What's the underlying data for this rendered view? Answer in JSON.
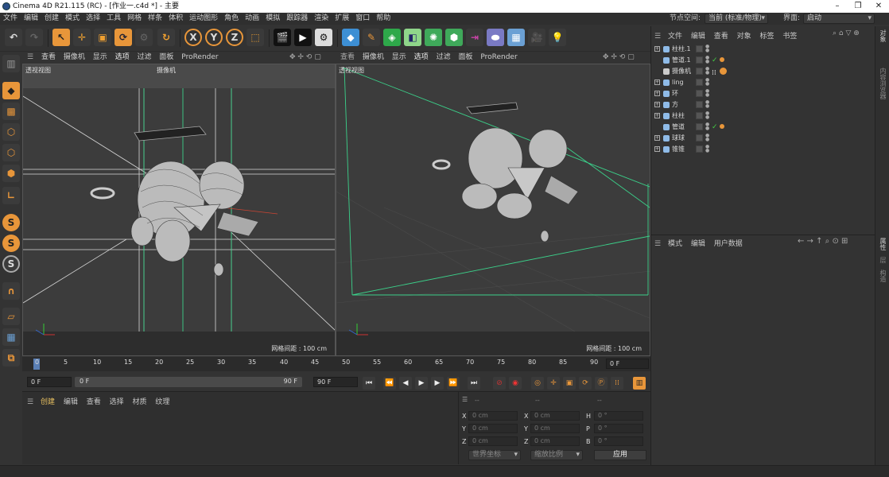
{
  "window": {
    "title": "Cinema 4D R21.115 (RC) - [作业一.c4d *] - 主要",
    "minimize": "–",
    "maximize": "❐",
    "close": "✕"
  },
  "menu": {
    "items": [
      "文件",
      "编辑",
      "创建",
      "模式",
      "选择",
      "工具",
      "网格",
      "样条",
      "体积",
      "运动图形",
      "角色",
      "动画",
      "模拟",
      "跟踪器",
      "渲染",
      "扩展",
      "窗口",
      "帮助"
    ],
    "node_space_label": "节点空间:",
    "node_space_value": "当前 (标准/物理)",
    "layout_label": "界面:",
    "layout_value": "启动"
  },
  "toolbar": {
    "axis_x": "X",
    "axis_y": "Y",
    "axis_z": "Z"
  },
  "viewports": {
    "menu": [
      "查看",
      "摄像机",
      "显示",
      "选项",
      "过滤",
      "面板",
      "ProRender"
    ],
    "left": {
      "name": "透视视图",
      "camera": "摄像机",
      "grid_spacing": "网格间距 : 100 cm"
    },
    "right": {
      "name": "透视视图",
      "grid_spacing": "网格间距 : 100 cm"
    }
  },
  "timeline": {
    "ticks": [
      "0",
      "5",
      "10",
      "15",
      "20",
      "25",
      "30",
      "35",
      "40",
      "45",
      "50",
      "55",
      "60",
      "65",
      "70",
      "75",
      "80",
      "85",
      "90"
    ],
    "current_frame": "0 F",
    "start_frame": "0 F",
    "range_start": "0 F",
    "range_end": "90 F",
    "end_frame": "90 F"
  },
  "material_manager": {
    "menu": [
      "创建",
      "编辑",
      "查看",
      "选择",
      "材质",
      "纹理"
    ]
  },
  "coordinates": {
    "headers": [
      "--",
      "--",
      "--"
    ],
    "rows": [
      {
        "a": "X",
        "av": "0 cm",
        "b": "X",
        "bv": "0 cm",
        "c": "H",
        "cv": "0 °"
      },
      {
        "a": "Y",
        "av": "0 cm",
        "b": "Y",
        "bv": "0 cm",
        "c": "P",
        "cv": "0 °"
      },
      {
        "a": "Z",
        "av": "0 cm",
        "b": "Z",
        "bv": "0 cm",
        "c": "B",
        "cv": "0 °"
      }
    ],
    "space": "世界坐标",
    "scale": "缩放比例",
    "apply": "应用"
  },
  "object_manager": {
    "menu": [
      "文件",
      "编辑",
      "查看",
      "对象",
      "标签",
      "书签"
    ],
    "objects": [
      "柱柱.1",
      "管道.1",
      "摄像机",
      "ling",
      "环",
      "方",
      "柱柱",
      "管道",
      "球球",
      "锥锥"
    ]
  },
  "attribute_manager": {
    "menu": [
      "模式",
      "编辑",
      "用户数据"
    ]
  },
  "right_tabs": [
    "对象",
    "内容浏览器",
    "属性",
    "层",
    "构造"
  ]
}
